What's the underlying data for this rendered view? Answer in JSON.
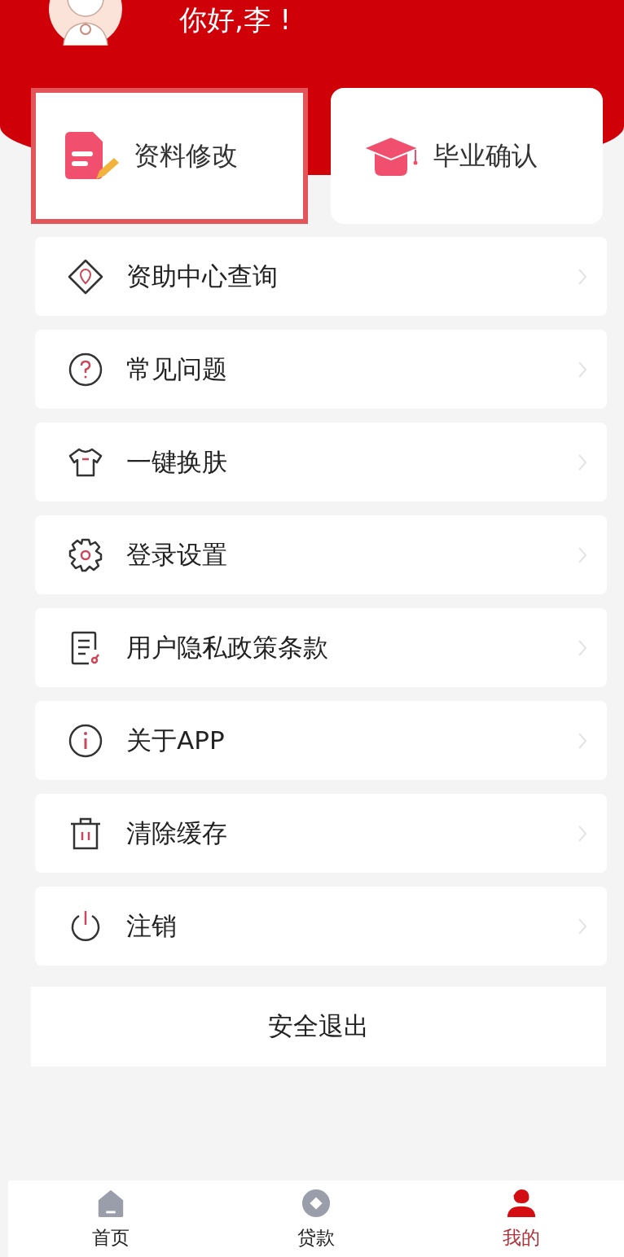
{
  "header": {
    "greeting": "你好,李 !"
  },
  "quick_actions": [
    {
      "label": "资料修改",
      "highlighted": true
    },
    {
      "label": "毕业确认",
      "highlighted": false
    }
  ],
  "menu": [
    {
      "label": "资助中心查询"
    },
    {
      "label": "常见问题"
    },
    {
      "label": "一键换肤"
    },
    {
      "label": "登录设置"
    },
    {
      "label": "用户隐私政策条款"
    },
    {
      "label": "关于APP"
    },
    {
      "label": "清除缓存"
    },
    {
      "label": "注销"
    }
  ],
  "logout_button": "安全退出",
  "tab_bar": [
    {
      "label": "首页",
      "selected": false
    },
    {
      "label": "贷款",
      "selected": false
    },
    {
      "label": "我的",
      "selected": true
    }
  ]
}
